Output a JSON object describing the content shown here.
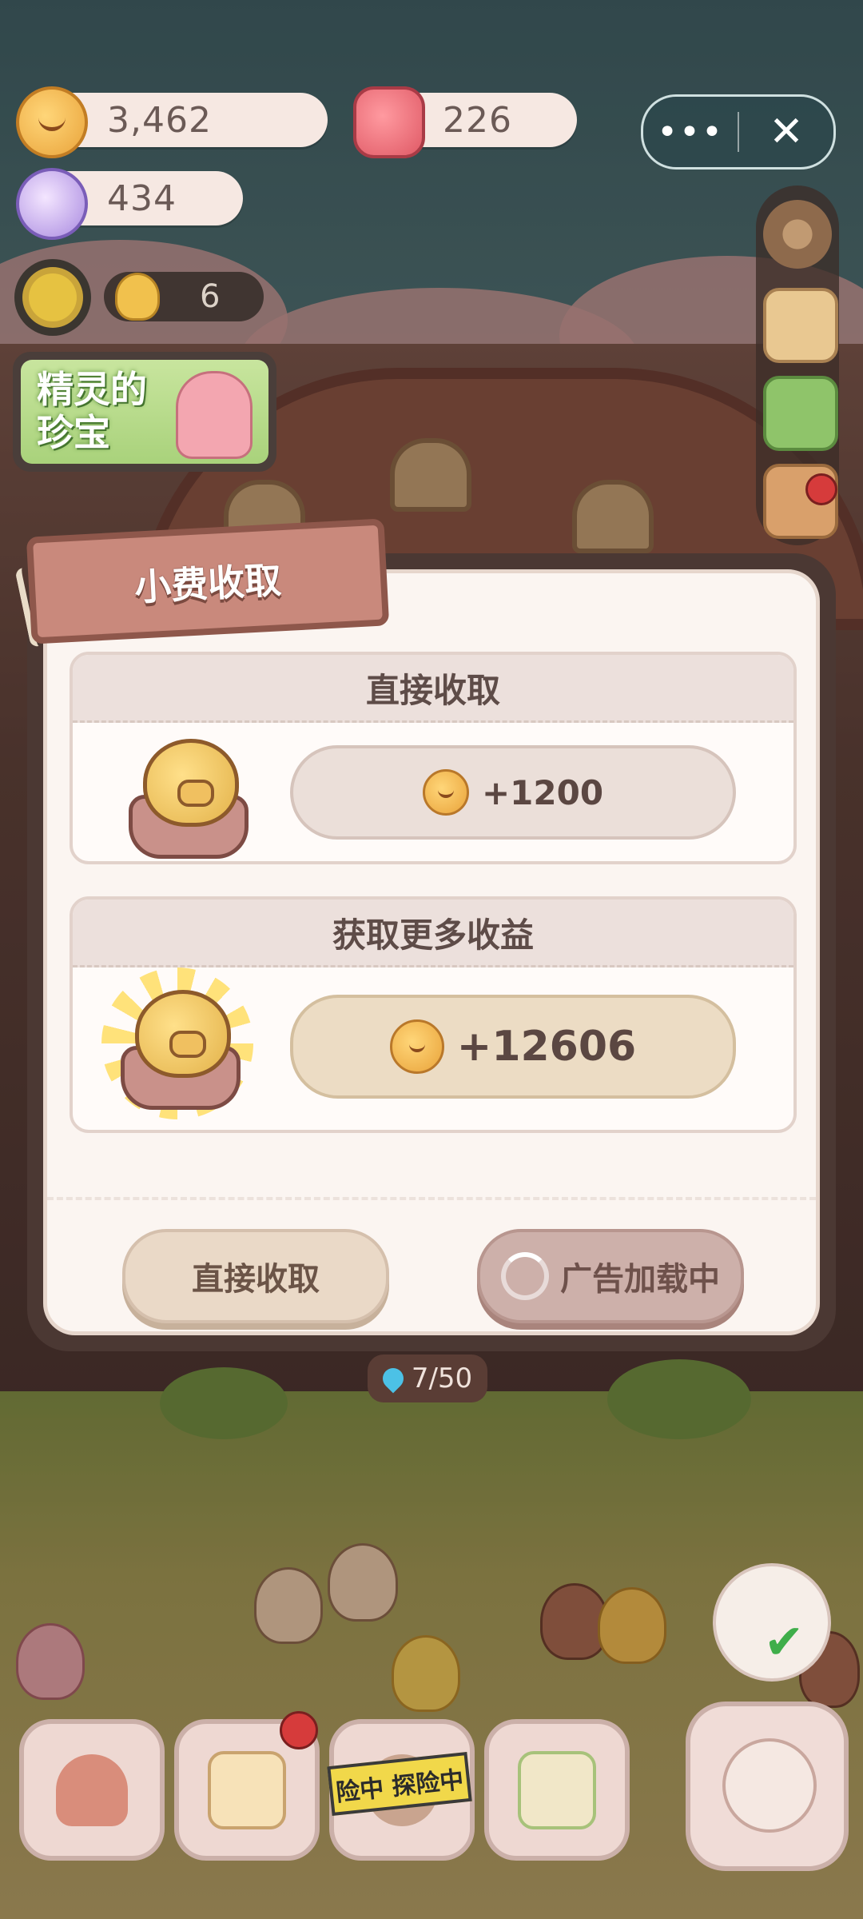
{
  "hud": {
    "cookies": "3,462",
    "gems": "226",
    "candy": "434",
    "workers": "6",
    "event_banner_text": "精灵的珍宝"
  },
  "miniprogram_capsule": {
    "more_icon": "more-dots-icon",
    "close_icon": "close-icon"
  },
  "modal": {
    "title": "小费收取",
    "direct_section": {
      "header": "直接收取",
      "reward": "+1200"
    },
    "bonus_section": {
      "header": "获取更多收益",
      "reward": "+12606"
    },
    "buttons": {
      "direct": "直接收取",
      "ad_loading": "广告加载中"
    }
  },
  "capacity": "7/50",
  "bottom_nav": {
    "explore_tape": "险中 探险中"
  },
  "colors": {
    "modal_border": "#4b3833",
    "modal_bg": "#fbf5f1",
    "title_tag": "#c9897c",
    "reward_highlight": "#ecdcc4",
    "badge_red": "#d63b3b"
  }
}
